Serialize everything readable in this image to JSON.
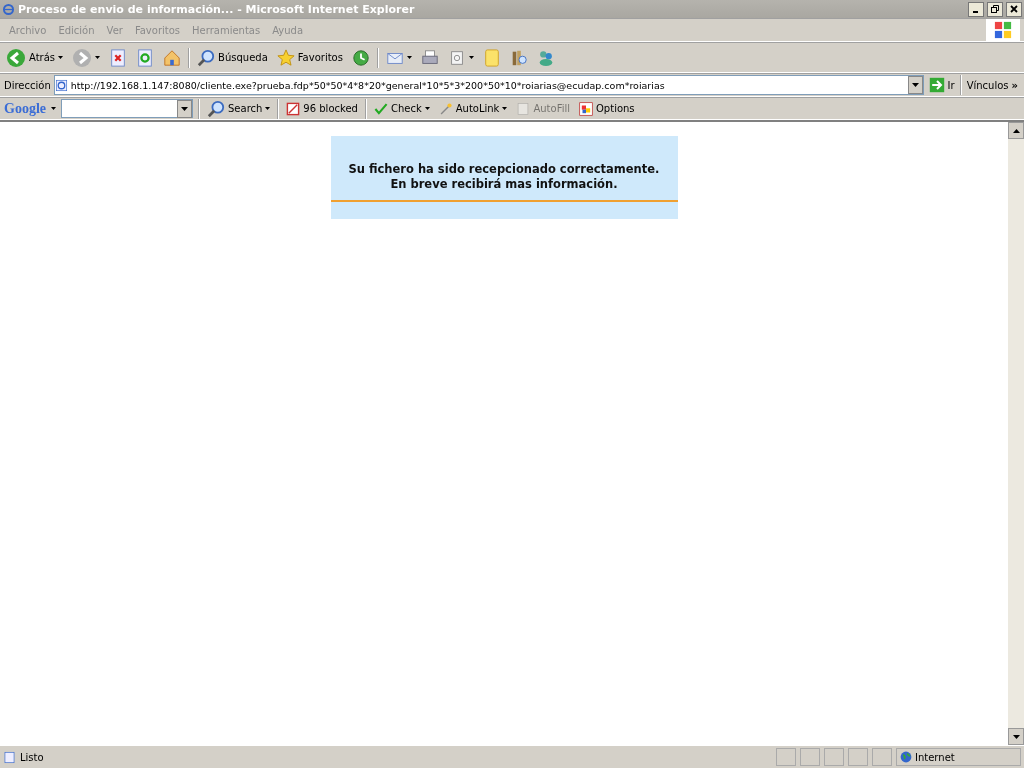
{
  "window": {
    "title": "Proceso de envio de información... - Microsoft Internet Explorer"
  },
  "menu": [
    "Archivo",
    "Edición",
    "Ver",
    "Favoritos",
    "Herramientas",
    "Ayuda"
  ],
  "toolbar": [
    {
      "kind": "back",
      "label": "Atrás",
      "dropdown": true
    },
    {
      "kind": "forward",
      "dropdown": true
    },
    {
      "kind": "stop",
      "dropdown": false
    },
    {
      "kind": "refresh",
      "dropdown": false
    },
    {
      "kind": "home",
      "dropdown": false
    },
    {
      "kind": "search",
      "label": "Búsqueda",
      "dropdown": false
    },
    {
      "kind": "favorites",
      "label": "Favoritos",
      "dropdown": false
    },
    {
      "kind": "history",
      "dropdown": false
    },
    {
      "kind": "mail",
      "dropdown": true
    },
    {
      "kind": "print",
      "dropdown": false
    },
    {
      "kind": "edit",
      "dropdown": true
    },
    {
      "kind": "note",
      "dropdown": false
    },
    {
      "kind": "research",
      "dropdown": false
    },
    {
      "kind": "messenger",
      "dropdown": false
    }
  ],
  "address": {
    "label": "Dirección",
    "value": "http://192.168.1.147:8080/cliente.exe?prueba.fdp*50*50*4*8*20*general*10*5*3*200*50*10*roiarias@ecudap.com*roiarias",
    "go": "Ir",
    "links": "Vínculos",
    "more": "»"
  },
  "google": {
    "logo": "Google",
    "items": [
      {
        "kind": "search",
        "label": "Search",
        "dropdown": true,
        "disabled": false
      },
      {
        "kind": "popup",
        "label": "96 blocked",
        "dropdown": false,
        "disabled": false
      },
      {
        "kind": "check",
        "label": "Check",
        "dropdown": true,
        "disabled": false
      },
      {
        "kind": "autolink",
        "label": "AutoLink",
        "dropdown": true,
        "disabled": false
      },
      {
        "kind": "autofill",
        "label": "AutoFill",
        "dropdown": false,
        "disabled": true
      },
      {
        "kind": "options",
        "label": "Options",
        "dropdown": false,
        "disabled": false
      }
    ]
  },
  "message": {
    "lines": [
      "Su fichero ha sido recepcionado correctamente.",
      "En breve recibirá mas información."
    ]
  },
  "status_bar": {
    "text": "Listo",
    "zone": "Internet"
  }
}
